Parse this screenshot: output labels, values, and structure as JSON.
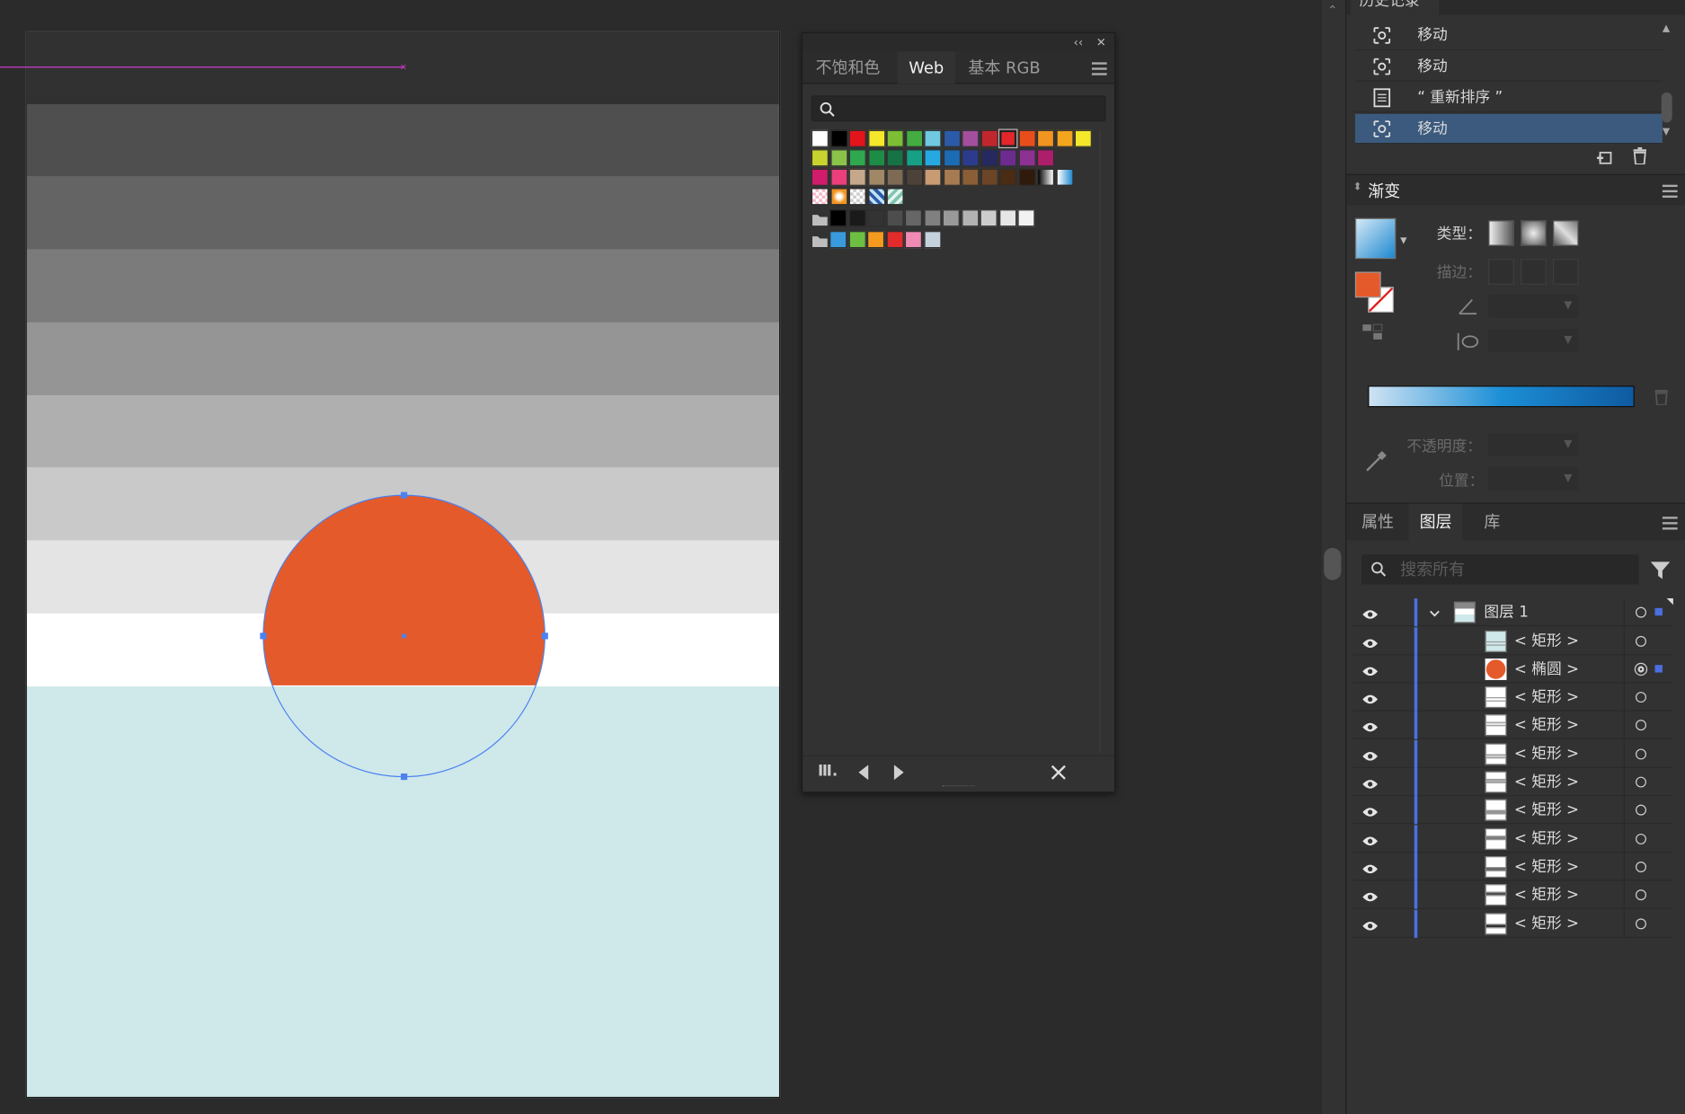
{
  "colors": {
    "accent": "#3b5a7e",
    "layer_color": "#4b6fe0",
    "selection_blue": "#4b82f0",
    "sun_orange": "#e45a2a",
    "guide_magenta": "#d23ad2"
  },
  "artboard": {
    "bands": [
      "#313131",
      "#4f4f4f",
      "#646464",
      "#7b7b7b",
      "#959595",
      "#afafaf",
      "#c9c9c9",
      "#e4e4e4",
      "#ffffff"
    ],
    "water_color": "#cfe8ea"
  },
  "swatches": {
    "tabs": [
      "不饱和色",
      "Web",
      "基本 RGB"
    ],
    "active_tab": "Web",
    "rows": [
      [
        "#ffffff",
        "#000000",
        "#e3151b",
        "#f5e82a",
        "#7dbe34",
        "#45ac42",
        "#70c9e0",
        "#2b5ba8",
        "#a34f9e",
        "#c0272d",
        "#e3262b",
        "#e84e1b",
        "#f29420",
        "#f3a51d",
        "#f5e82a"
      ],
      [
        "#c8d32f",
        "#8bc34a",
        "#2fa84f",
        "#1d8c46",
        "#177245",
        "#16a085",
        "#26a9e0",
        "#1c6cb4",
        "#2b3c8f",
        "#25295f",
        "#6d2b8f",
        "#8d3192",
        "#ad1e6b"
      ],
      [
        "#d01c6b",
        "#ea3f7b",
        "#c5a88b",
        "#a08766",
        "#7d6a55",
        "#4d4238",
        "#c89b72",
        "#a77b52",
        "#8a5e36",
        "#6b4525",
        "#4a2b14",
        "#301a0c",
        "gradient-bw",
        "gradient-blue"
      ],
      [
        "pattern-pink",
        "pattern-orange",
        "pattern-check",
        "pattern-blue",
        "pattern-teal"
      ],
      [
        "folder",
        "#000000",
        "#1a1a1a",
        "#333333",
        "#4d4d4d",
        "#666666",
        "#808080",
        "#999999",
        "#b3b3b3",
        "#cccccc",
        "#e6e6e6",
        "#f2f2f2"
      ],
      [
        "folder",
        "#3a9bdc",
        "#6cbf43",
        "#f39a1f",
        "#e32b2b",
        "#f08bb4",
        "#c3d2dc"
      ]
    ]
  },
  "history": {
    "tab_label": "历史记录",
    "items": [
      {
        "label": "移动",
        "icon": "move-icon"
      },
      {
        "label": "移动",
        "icon": "move-icon"
      },
      {
        "label": "“ 重新排序 ”",
        "icon": "document-icon"
      },
      {
        "label": "移动",
        "icon": "move-icon",
        "selected": true
      }
    ]
  },
  "gradient": {
    "title": "渐变",
    "type_label": "类型：",
    "stroke_label": "描边：",
    "opacity_label": "不透明度：",
    "position_label": "位置："
  },
  "layers": {
    "tabs": [
      "属性",
      "图层",
      "库"
    ],
    "active_tab": "图层",
    "search_placeholder": "搜索所有",
    "top_layer": "图层 1",
    "items": [
      {
        "name": "< 矩形 >",
        "thumb": "#cfe8ea"
      },
      {
        "name": "< 椭圆 >",
        "thumb": "circle",
        "selected": true
      },
      {
        "name": "< 矩形 >",
        "thumb": "#ffffff"
      },
      {
        "name": "< 矩形 >",
        "thumb": "#e4e4e4"
      },
      {
        "name": "< 矩形 >",
        "thumb": "#c9c9c9"
      },
      {
        "name": "< 矩形 >",
        "thumb": "#afafaf"
      },
      {
        "name": "< 矩形 >",
        "thumb": "#959595"
      },
      {
        "name": "< 矩形 >",
        "thumb": "#7b7b7b"
      },
      {
        "name": "< 矩形 >",
        "thumb": "#646464"
      },
      {
        "name": "< 矩形 >",
        "thumb": "#4f4f4f"
      },
      {
        "name": "< 矩形 >",
        "thumb": "#313131"
      }
    ]
  }
}
